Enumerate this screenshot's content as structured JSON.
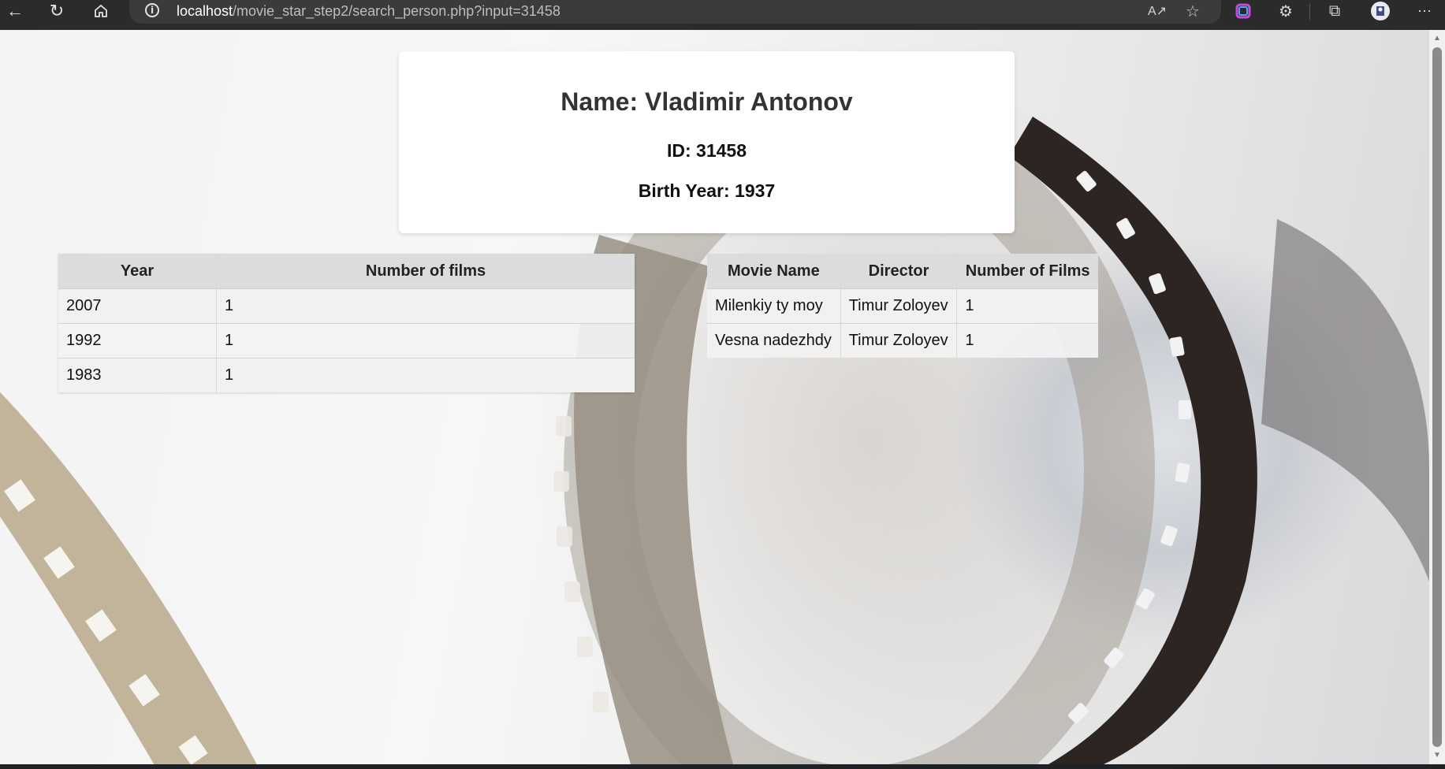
{
  "browser": {
    "url_host": "localhost",
    "url_path": "/movie_star_step2/search_person.php?input=31458",
    "back_icon": "back-arrow-icon",
    "refresh_icon": "refresh-icon",
    "home_icon": "home-icon",
    "info_icon": "site-info-icon",
    "read_aloud_icon": "read-aloud-icon",
    "favorites_icon": "add-favorite-icon",
    "copilot_icon": "copilot-icon",
    "extensions_icon": "extensions-icon",
    "collections_icon": "collections-icon",
    "profile_icon": "profile-avatar-icon",
    "menu_icon": "more-menu-icon"
  },
  "person": {
    "name_line": "Name: Vladimir Antonov",
    "id_line": "ID: 31458",
    "birth_line": "Birth Year: 1937"
  },
  "films_by_year": {
    "headers": [
      "Year",
      "Number of films"
    ],
    "rows": [
      [
        "2007",
        "1"
      ],
      [
        "1992",
        "1"
      ],
      [
        "1983",
        "1"
      ]
    ]
  },
  "movies": {
    "headers": [
      "Movie Name",
      "Director",
      "Number of Films"
    ],
    "rows": [
      [
        "Milenkiy ty moy",
        "Timur Zoloyev",
        "1"
      ],
      [
        "Vesna nadezhdy",
        "Timur Zoloyev",
        "1"
      ]
    ]
  },
  "colors": {
    "chrome_bg": "#2b2b2b",
    "address_bg": "#3b3b3b",
    "card_bg": "#ffffff",
    "table_header_bg": "#dcdcdc"
  }
}
